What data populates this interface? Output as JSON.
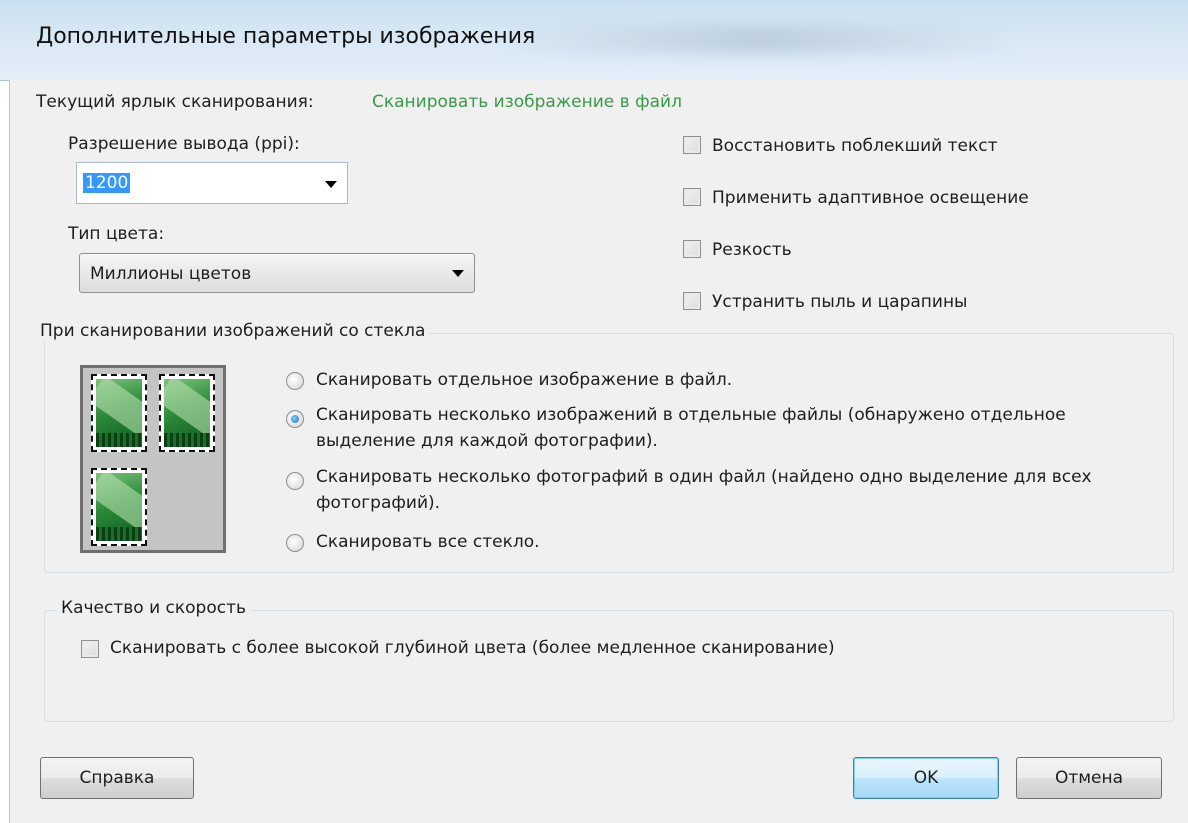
{
  "window": {
    "title": "Дополнительные параметры изображения"
  },
  "shortcut": {
    "label": "Текущий ярлык сканирования:",
    "value": "Сканировать изображение в файл"
  },
  "resolution": {
    "label": "Разрешение вывода (ppi):",
    "value": "1200"
  },
  "color_type": {
    "label": "Тип цвета:",
    "value": "Миллионы цветов"
  },
  "options": {
    "restore_faded": {
      "label": "Восстановить поблекший текст",
      "checked": false
    },
    "adaptive_lighting": {
      "label": "Применить адаптивное освещение",
      "checked": false
    },
    "sharpen": {
      "label": "Резкость",
      "checked": false
    },
    "remove_dust": {
      "label": "Устранить пыль и царапины",
      "checked": false
    }
  },
  "glass_group": {
    "title": "При сканировании изображений со стекла",
    "radios": [
      {
        "label": "Сканировать отдельное изображение в файл.",
        "checked": false
      },
      {
        "label": "Сканировать несколько изображений в отдельные файлы (обнаружено отдельное выделение для каждой фотографии).",
        "checked": true
      },
      {
        "label": "Сканировать несколько фотографий в один файл (найдено одно выделение для всех фотографий).",
        "checked": false
      },
      {
        "label": "Сканировать все стекло.",
        "checked": false
      }
    ]
  },
  "quality_group": {
    "title": "Качество и скорость",
    "high_depth": {
      "label": "Сканировать с более высокой глубиной цвета (более медленное сканирование)",
      "checked": false
    }
  },
  "buttons": {
    "help": "Справка",
    "ok": "OK",
    "cancel": "Отмена"
  },
  "colors": {
    "shortcut_value": "#3a9a49",
    "selection": "#3399ff",
    "default_button_border": "#3c7fb1"
  }
}
